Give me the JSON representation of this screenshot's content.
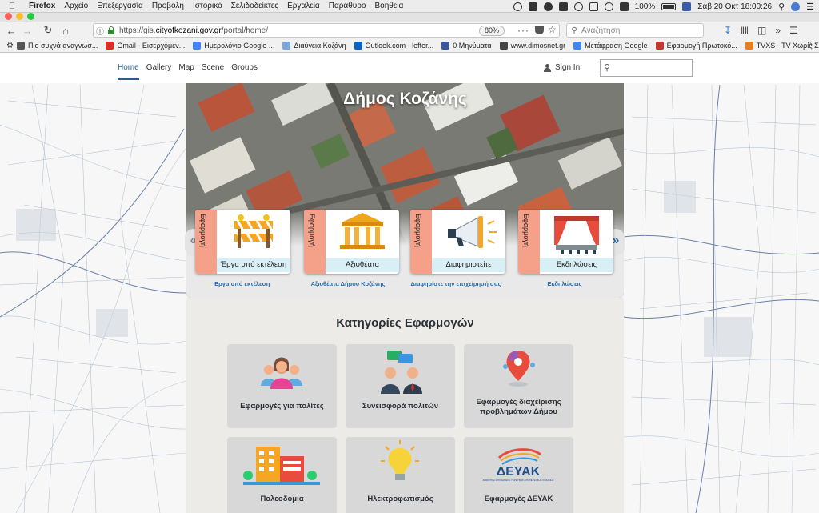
{
  "os_menubar": {
    "app": "Firefox",
    "menus": [
      "Αρχείο",
      "Επεξεργασία",
      "Προβολή",
      "Ιστορικό",
      "Σελιδοδείκτες",
      "Εργαλεία",
      "Παράθυρο",
      "Βοηθεια"
    ],
    "battery": "100%",
    "clock": "Σάβ 20 Οκτ  18:00:26"
  },
  "browser": {
    "url_prefix": "https://gis.",
    "url_domain": "cityofkozani.gov.gr",
    "url_path": "/portal/home/",
    "zoom": "80%",
    "search_placeholder": "Αναζήτηση",
    "bookmarks": [
      {
        "label": "Πιο συχνά αναγνωσ...",
        "color": "#555555"
      },
      {
        "label": "Gmail - Εισερχόμεν...",
        "color": "#d93025"
      },
      {
        "label": "Ημερολόγιο Google ...",
        "color": "#4285f4"
      },
      {
        "label": "Διαύγεια Κοζάνη",
        "color": "#7aa7d8"
      },
      {
        "label": "Outlook.com - lefter...",
        "color": "#0a64c8"
      },
      {
        "label": "0 Μηνύματα",
        "color": "#3b5998"
      },
      {
        "label": "www.dimosnet.gr",
        "color": "#444444"
      },
      {
        "label": "Μετάφραση Google",
        "color": "#4285f4"
      },
      {
        "label": "Εφαρμογή Πρωτοκό...",
        "color": "#c0392b"
      },
      {
        "label": "TVXS - TV Χωρίς Σ...",
        "color": "#e67e22"
      }
    ]
  },
  "portal": {
    "nav": [
      "Home",
      "Gallery",
      "Map",
      "Scene",
      "Groups"
    ],
    "sign_in": "Sign In",
    "hero_title": "Δήμος Κοζάνης",
    "cards": [
      {
        "tag": "Εφαρμογή",
        "caption": "Έργα υπό εκτέλεση",
        "link": "Έργα υπό εκτέλεση",
        "icon": "roadwork-barrier-icon"
      },
      {
        "tag": "Εφαρμογή",
        "caption": "Αξιοθέατα",
        "link": "Αξιοθέατα Δήμου Κοζάνης",
        "icon": "temple-icon"
      },
      {
        "tag": "Εφαρμογή",
        "caption": "Διαφημιστείτε",
        "link": "Διαφημίστε την επιχείρησή σας",
        "icon": "megaphone-icon"
      },
      {
        "tag": "Εφαρμογή",
        "caption": "Εκδηλώσεις",
        "link": "Εκδηλώσεις",
        "icon": "theater-stage-icon"
      }
    ],
    "categories_title": "Κατηγορίες Εφαρμογών",
    "tiles": [
      {
        "label": "Εφαρμογές για πολίτες",
        "icon": "citizens-group-icon"
      },
      {
        "label": "Συνεισφορά πολιτών",
        "icon": "citizens-chat-icon"
      },
      {
        "label": "Εφαρμογές διαχείρισης προβλημάτων Δήμου",
        "icon": "problem-pin-icon"
      },
      {
        "label": "Πολεοδομία",
        "icon": "buildings-icon"
      },
      {
        "label": "Ηλεκτροφωτισμός",
        "icon": "lightbulb-icon"
      },
      {
        "label": "Εφαρμογές ΔΕΥΑΚ",
        "icon": "deyak-logo-icon"
      }
    ],
    "deyak_logo_text": "ΔΕΥΑΚ",
    "deyak_logo_subtitle": "ΔΗΜΟΤΙΚΗ ΕΠΙΧΕΙΡΗΣΗ ΥΔΡΕΥΣΗΣ ΑΠΟΧΕΤΕΥΣΗΣ ΚΟΖΑΝΗΣ"
  }
}
